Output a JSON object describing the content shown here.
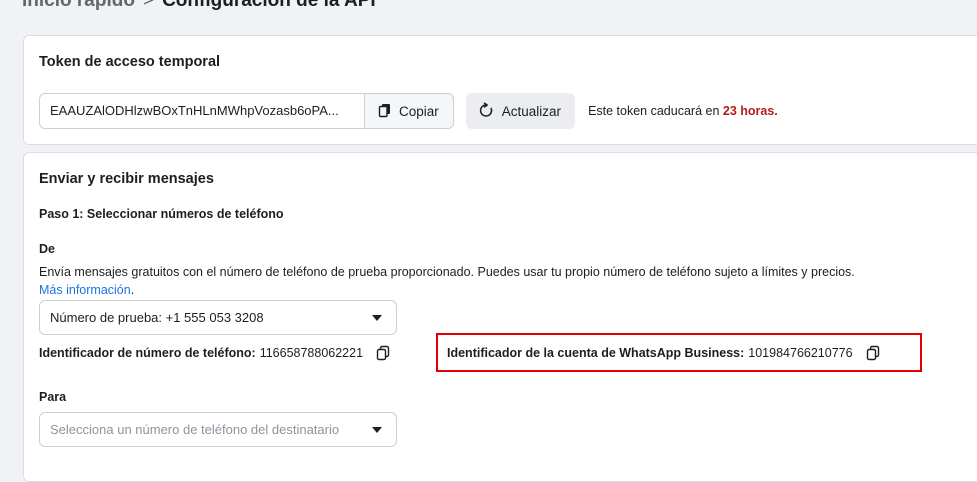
{
  "breadcrumb": {
    "first": "Inicio rápido",
    "separator": ">",
    "current": "Configuración de la API"
  },
  "token_card": {
    "title": "Token de acceso temporal",
    "token_value": "EAAUZAlODHlzwBOxTnHLnMWhpVozasb6oPA...",
    "copy_label": "Copiar",
    "refresh_label": "Actualizar",
    "expiry_prefix": "Este token caducará en ",
    "expiry_hours": "23 horas."
  },
  "send_card": {
    "title": "Enviar y recibir mensajes",
    "step1": "Paso 1: Seleccionar números de teléfono",
    "from_label": "De",
    "from_description": "Envía mensajes gratuitos con el número de teléfono de prueba proporcionado. Puedes usar tu propio número de teléfono sujeto a límites y precios.",
    "more_info": "Más información",
    "more_info_suffix": ".",
    "from_select_value": "Número de prueba: +1 555 053 3208",
    "phone_id_label": "Identificador de número de teléfono:",
    "phone_id_value": "116658788062221",
    "waba_id_label": "Identificador de la cuenta de WhatsApp Business:",
    "waba_id_value": "101984766210776",
    "to_label": "Para",
    "to_select_placeholder": "Selecciona un número de teléfono del destinatario"
  },
  "colors": {
    "expiry_highlight": "#b71c1c",
    "link": "#1b74e4",
    "highlight_box": "#e00000"
  },
  "icons": {
    "copy": "copy-icon",
    "refresh": "refresh-icon",
    "caret": "caret-down-icon"
  }
}
